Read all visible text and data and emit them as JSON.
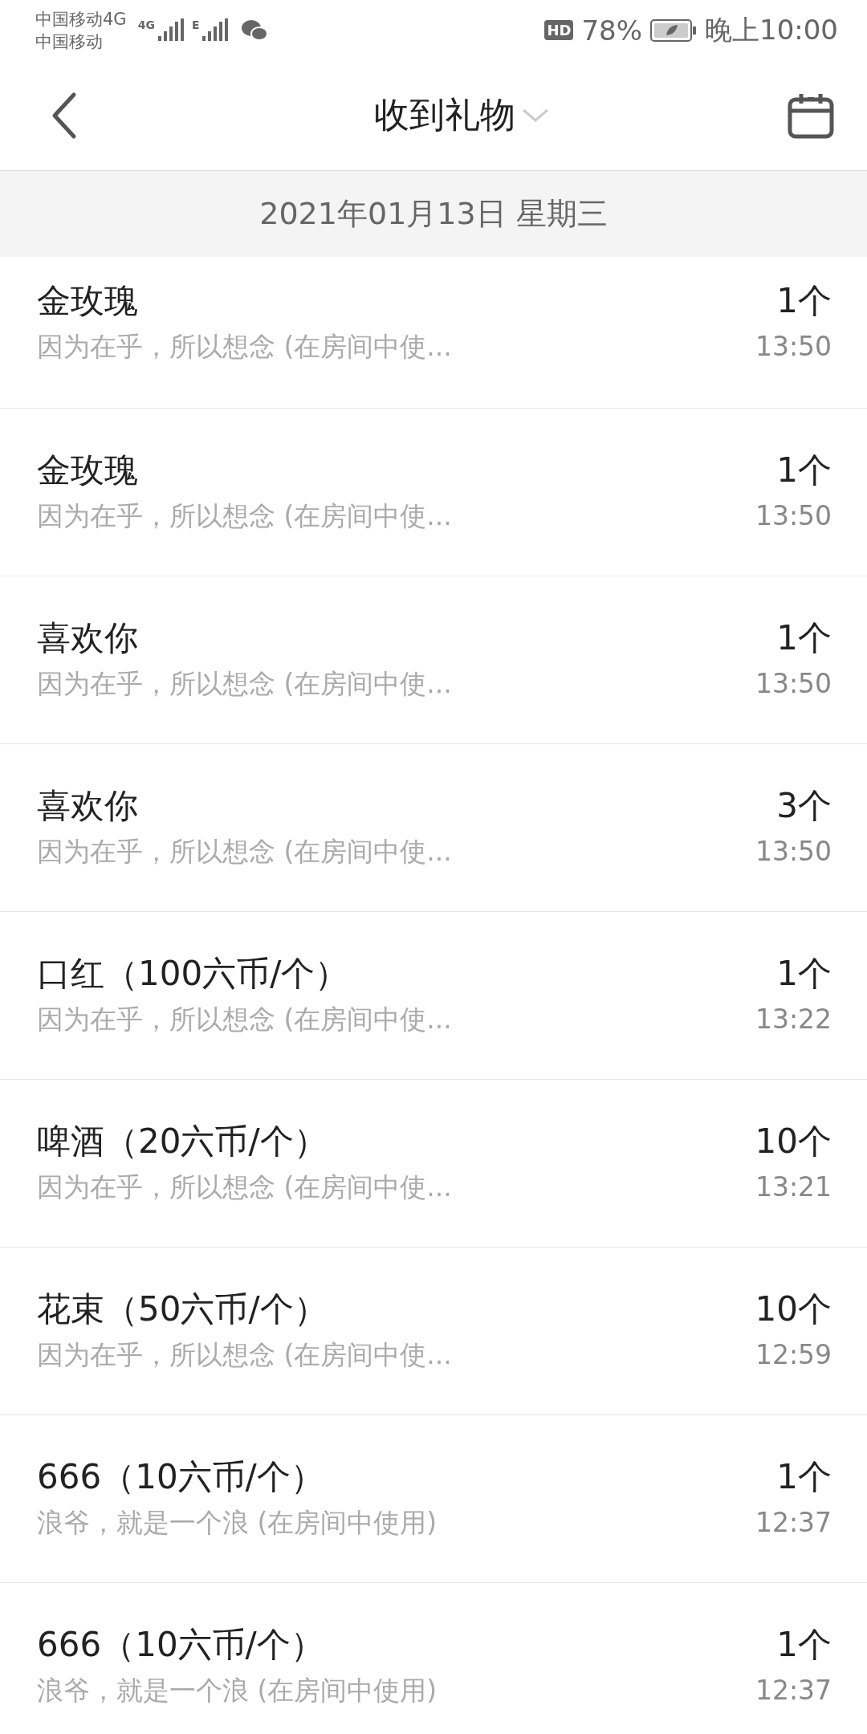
{
  "status_bar": {
    "carrier_1": "中国移动4G",
    "carrier_2": "中国移动",
    "network_1": "4G",
    "network_2": "E",
    "hd": "HD",
    "battery": "78%",
    "time": "晚上10:00"
  },
  "header": {
    "title": "收到礼物"
  },
  "date": "2021年01月13日 星期三",
  "gifts": [
    {
      "name": "金玫瑰",
      "message": "因为在乎，所以想念 (在房间中使...",
      "count": "1个",
      "time": "13:50"
    },
    {
      "name": "金玫瑰",
      "message": "因为在乎，所以想念 (在房间中使...",
      "count": "1个",
      "time": "13:50"
    },
    {
      "name": "喜欢你",
      "message": "因为在乎，所以想念 (在房间中使...",
      "count": "1个",
      "time": "13:50"
    },
    {
      "name": "喜欢你",
      "message": "因为在乎，所以想念 (在房间中使...",
      "count": "3个",
      "time": "13:50"
    },
    {
      "name": "口红（100六币/个）",
      "message": "因为在乎，所以想念 (在房间中使...",
      "count": "1个",
      "time": "13:22"
    },
    {
      "name": "啤酒（20六币/个）",
      "message": "因为在乎，所以想念 (在房间中使...",
      "count": "10个",
      "time": "13:21"
    },
    {
      "name": "花束（50六币/个）",
      "message": "因为在乎，所以想念 (在房间中使...",
      "count": "10个",
      "time": "12:59"
    },
    {
      "name": "666（10六币/个）",
      "message": "浪爷，就是一个浪 (在房间中使用)",
      "count": "1个",
      "time": "12:37"
    },
    {
      "name": "666（10六币/个）",
      "message": "浪爷，就是一个浪 (在房间中使用)",
      "count": "1个",
      "time": "12:37"
    }
  ]
}
